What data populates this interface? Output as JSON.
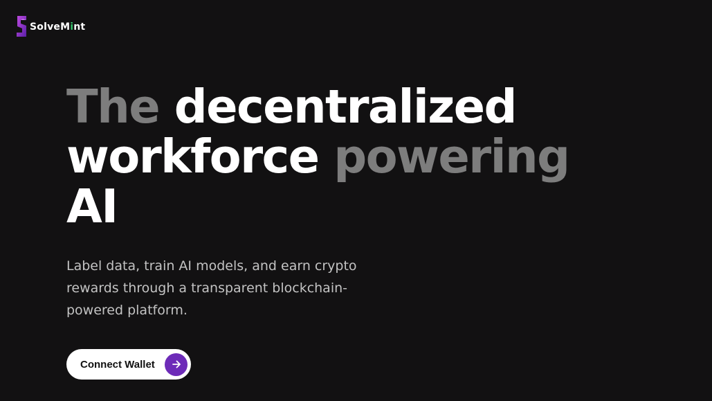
{
  "brand": {
    "logo_text_main": "SolveM",
    "logo_text_accent": "i",
    "logo_text_end": "nt",
    "colors": {
      "background": "#121112",
      "accent_green": "#36c46b",
      "accent_purple": "#6d2bb8",
      "headline_muted": "#7d7d7d"
    }
  },
  "hero": {
    "headline": {
      "part1_muted": "The",
      "part2": "decentralized workforce",
      "part3_muted": "powering",
      "part4": "AI"
    },
    "subtext": "Label data, train AI models, and earn crypto rewards through a transparent blockchain-powered platform.",
    "cta": {
      "label": "Connect Wallet",
      "icon": "arrow-right-icon"
    }
  }
}
